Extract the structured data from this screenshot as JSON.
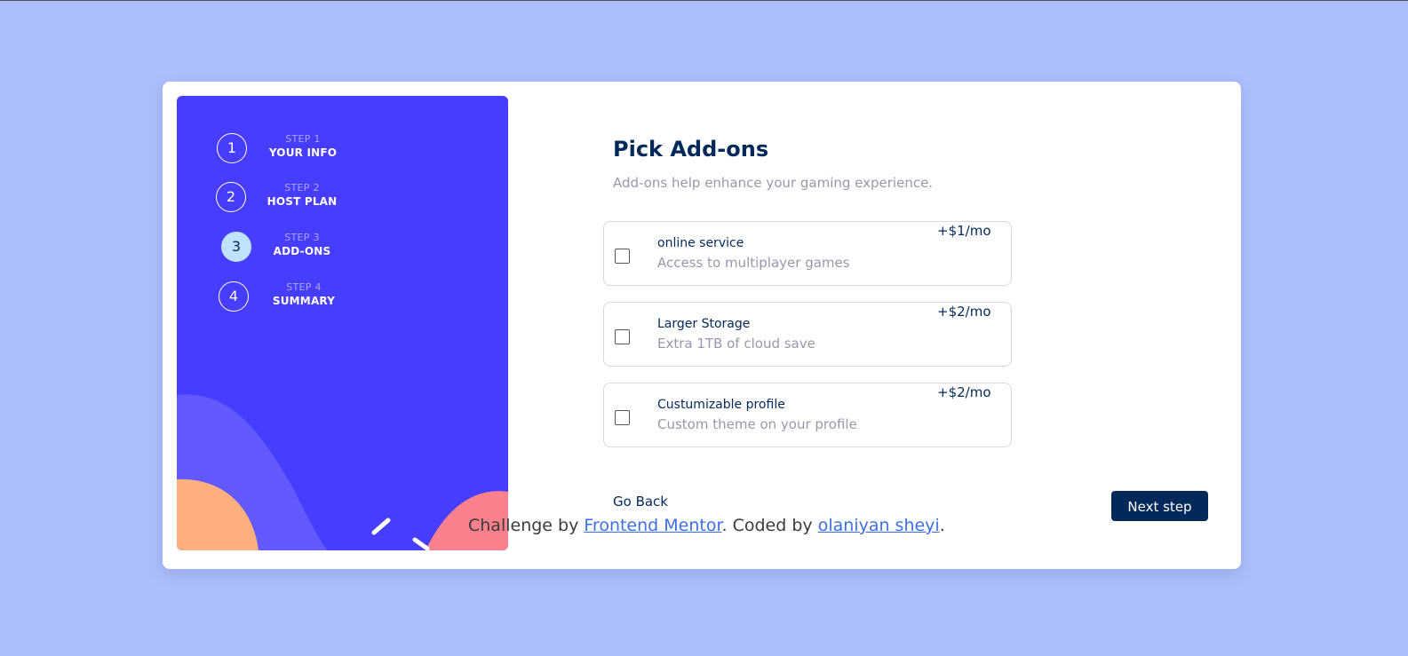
{
  "colors": {
    "background": "#adbefc",
    "sidebar": "#473dff",
    "primary_text": "#02295a",
    "muted_text": "#9699ab",
    "active_step": "#bfe2fd",
    "link": "#3d6fe6"
  },
  "sidebar": {
    "steps": [
      {
        "number": "1",
        "label": "STEP 1",
        "title": "YOUR INFO"
      },
      {
        "number": "2",
        "label": "STEP 2",
        "title": "HOST PLAN"
      },
      {
        "number": "3",
        "label": "STEP 3",
        "title": "ADD-ONS"
      },
      {
        "number": "4",
        "label": "STEP 4",
        "title": "SUMMARY"
      }
    ],
    "active_step": 3
  },
  "main": {
    "title": "Pick Add-ons",
    "subtitle": "Add-ons help enhance your gaming experience.",
    "addons": [
      {
        "name": "online service",
        "description": "Access to multiplayer games",
        "price": "+$1/mo",
        "checked": false
      },
      {
        "name": "Larger Storage",
        "description": "Extra 1TB of cloud save",
        "price": "+$2/mo",
        "checked": false
      },
      {
        "name": "Custumizable profile",
        "description": "Custom theme on your profile",
        "price": "+$2/mo",
        "checked": false
      }
    ],
    "back_label": "Go Back",
    "next_label": "Next step"
  },
  "attribution": {
    "prefix": "Challenge by ",
    "link1": "Frontend Mentor",
    "middle": ". Coded by ",
    "link2": "olaniyan sheyi",
    "suffix": "."
  }
}
